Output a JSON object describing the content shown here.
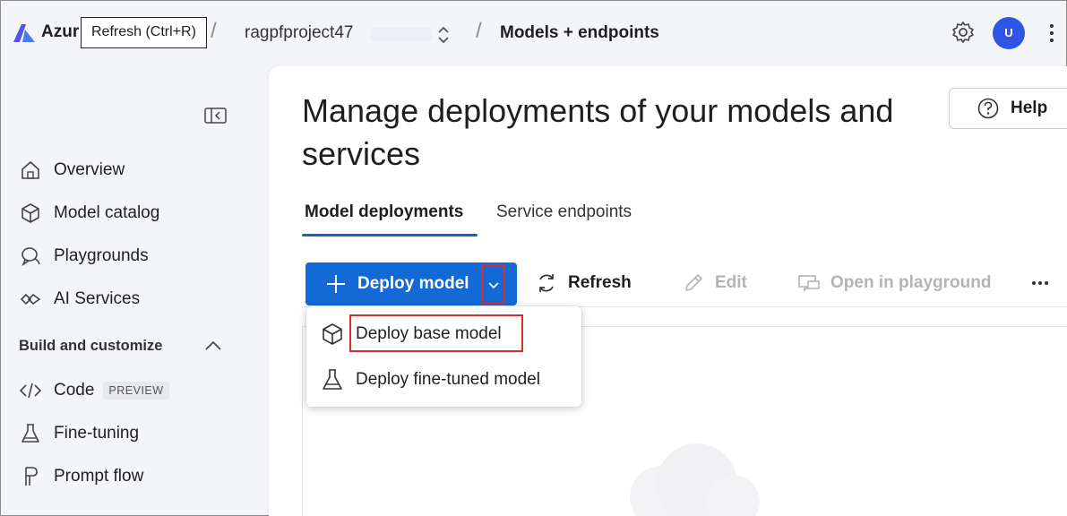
{
  "header": {
    "brand": "Azur",
    "tooltip": "Refresh (Ctrl+R)",
    "breadcrumb_separator": "/",
    "project_name": "ragpfproject47",
    "page_crumb": "Models + endpoints",
    "avatar_initial": "U"
  },
  "sidebar": {
    "items": [
      {
        "label": "Overview",
        "icon": "home-icon"
      },
      {
        "label": "Model catalog",
        "icon": "cube-icon"
      },
      {
        "label": "Playgrounds",
        "icon": "chat-icon"
      },
      {
        "label": "AI Services",
        "icon": "link-icon"
      }
    ],
    "section_heading": "Build and customize",
    "build_items": [
      {
        "label": "Code",
        "icon": "code-icon",
        "badge": "PREVIEW"
      },
      {
        "label": "Fine-tuning",
        "icon": "flask-icon"
      },
      {
        "label": "Prompt flow",
        "icon": "flow-icon"
      }
    ]
  },
  "main": {
    "title": "Manage deployments of your models and services",
    "help_label": "Help",
    "tabs": [
      {
        "label": "Model deployments",
        "active": true
      },
      {
        "label": "Service endpoints",
        "active": false
      }
    ],
    "toolbar": {
      "deploy_label": "Deploy model",
      "refresh_label": "Refresh",
      "edit_label": "Edit",
      "playground_label": "Open in playground"
    }
  },
  "deploy_menu": {
    "items": [
      {
        "label": "Deploy base model",
        "icon": "cube-icon"
      },
      {
        "label": "Deploy fine-tuned model",
        "icon": "flask-icon"
      }
    ]
  },
  "colors": {
    "primary": "#1369d6",
    "highlight": "#d32f2f",
    "avatar": "#2f54e6",
    "tab_underline": "#1a5fd0"
  }
}
